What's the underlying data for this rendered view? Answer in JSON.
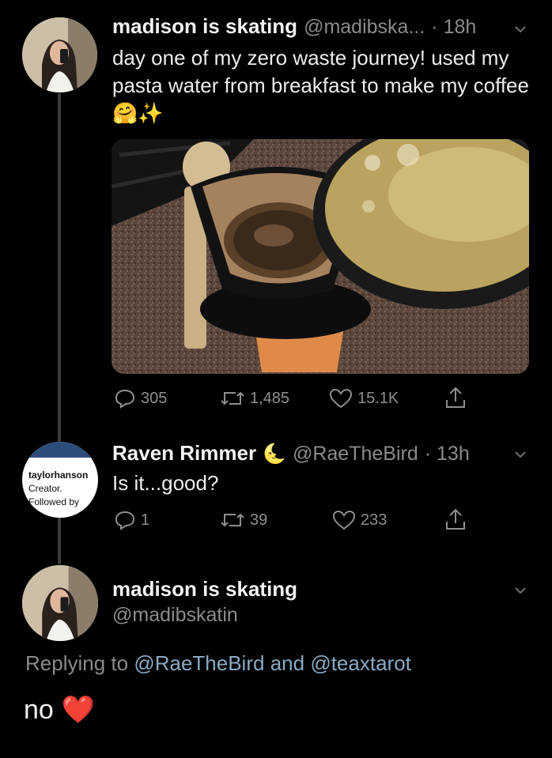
{
  "tweet1": {
    "display_name": "madison is skating",
    "handle": "@madibska...",
    "time": "· 18h",
    "text": "day one of my zero waste journey! used my pasta water from breakfast to make my coffee",
    "emoji": "🤗✨",
    "media_alt": "coffee brewing through a pour-over filter next to a pot of pasta water",
    "actions": {
      "replies": "305",
      "retweets": "1,485",
      "likes": "15.1K"
    }
  },
  "tweet2": {
    "display_name": "Raven Rimmer",
    "name_emoji": "🌜",
    "handle": "@RaeTheBird",
    "time": "· 13h",
    "text": "Is it...good?",
    "avatar_lines": [
      "taylorhanson",
      "Creator.",
      "Followed by"
    ],
    "actions": {
      "replies": "1",
      "retweets": "39",
      "likes": "233"
    }
  },
  "tweet3": {
    "display_name": "madison is skating",
    "handle": "@madibskatin",
    "replying_prefix": "Replying to",
    "replying_user1": "@RaeTheBird",
    "replying_and": "and",
    "replying_user2": "@teaxtarot",
    "text": "no",
    "emoji": "❤️"
  },
  "colors": {
    "background": "#000000",
    "text": "#ececec",
    "muted": "#8b8b8b",
    "link": "#8aa9c4",
    "heart": "#e0245e"
  }
}
